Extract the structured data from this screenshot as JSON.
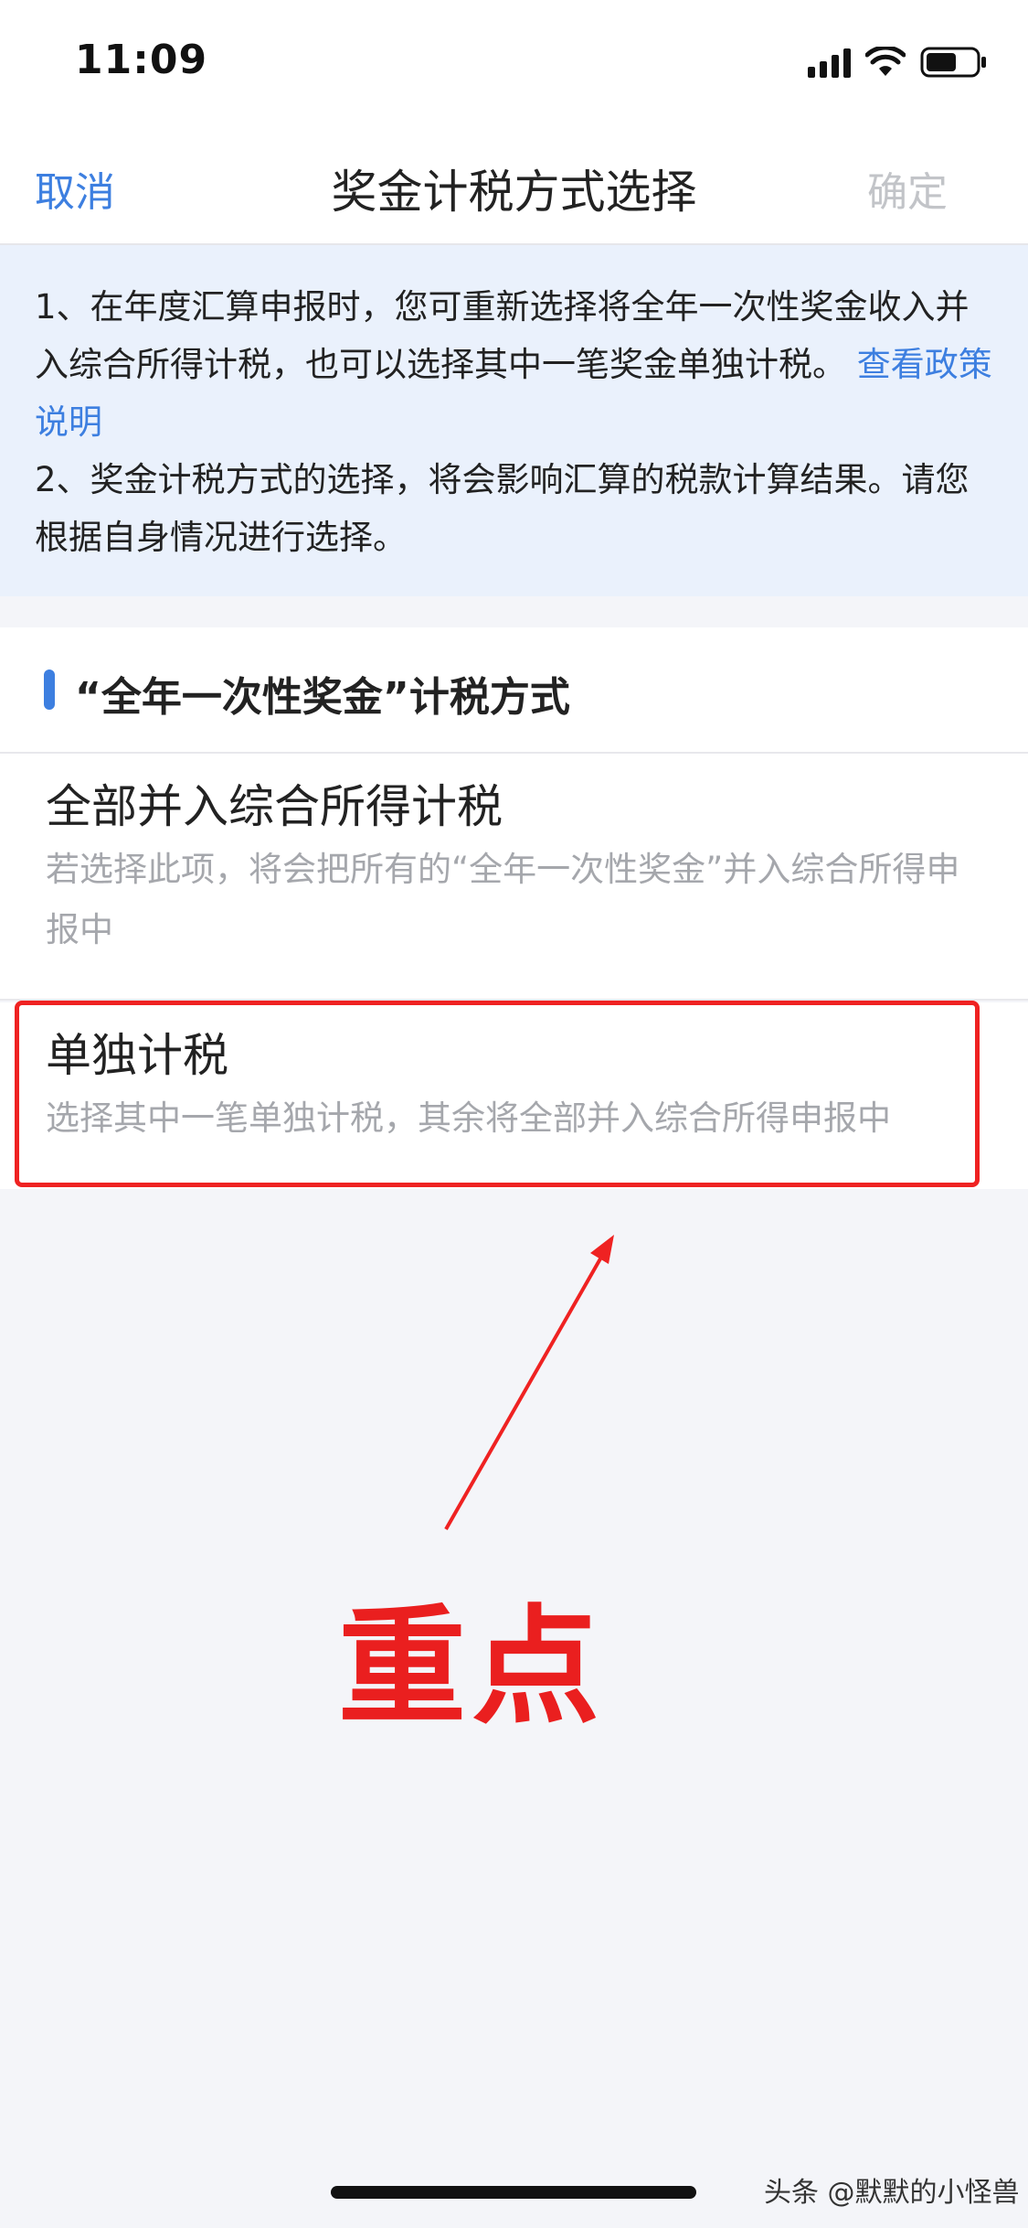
{
  "status_bar": {
    "time": "11:09"
  },
  "nav": {
    "cancel": "取消",
    "title": "奖金计税方式选择",
    "confirm": "确定"
  },
  "notice": {
    "line1": "1、在年度汇算申报时，您可重新选择将全年一次性奖金收入并入综合所得计税，也可以选择其中一笔奖金单独计税。",
    "link": "查看政策说明",
    "line2": "2、奖金计税方式的选择，将会影响汇算的税款计算结果。请您根据自身情况进行选择。"
  },
  "section": {
    "title": "“全年一次性奖金”计税方式"
  },
  "options": [
    {
      "title": "全部并入综合所得计税",
      "desc": "若选择此项，将会把所有的“全年一次性奖金”并入综合所得申报中"
    },
    {
      "title": "单独计税",
      "desc": "选择其中一笔单独计税，其余将全部并入综合所得申报中"
    }
  ],
  "annotation": {
    "text": "重点",
    "color": "#ea1f1f"
  },
  "watermark": "头条 @默默的小怪兽",
  "colors": {
    "accent": "#3d7fe0",
    "notice_bg": "#eaf1fc",
    "highlight": "#ef2222"
  }
}
